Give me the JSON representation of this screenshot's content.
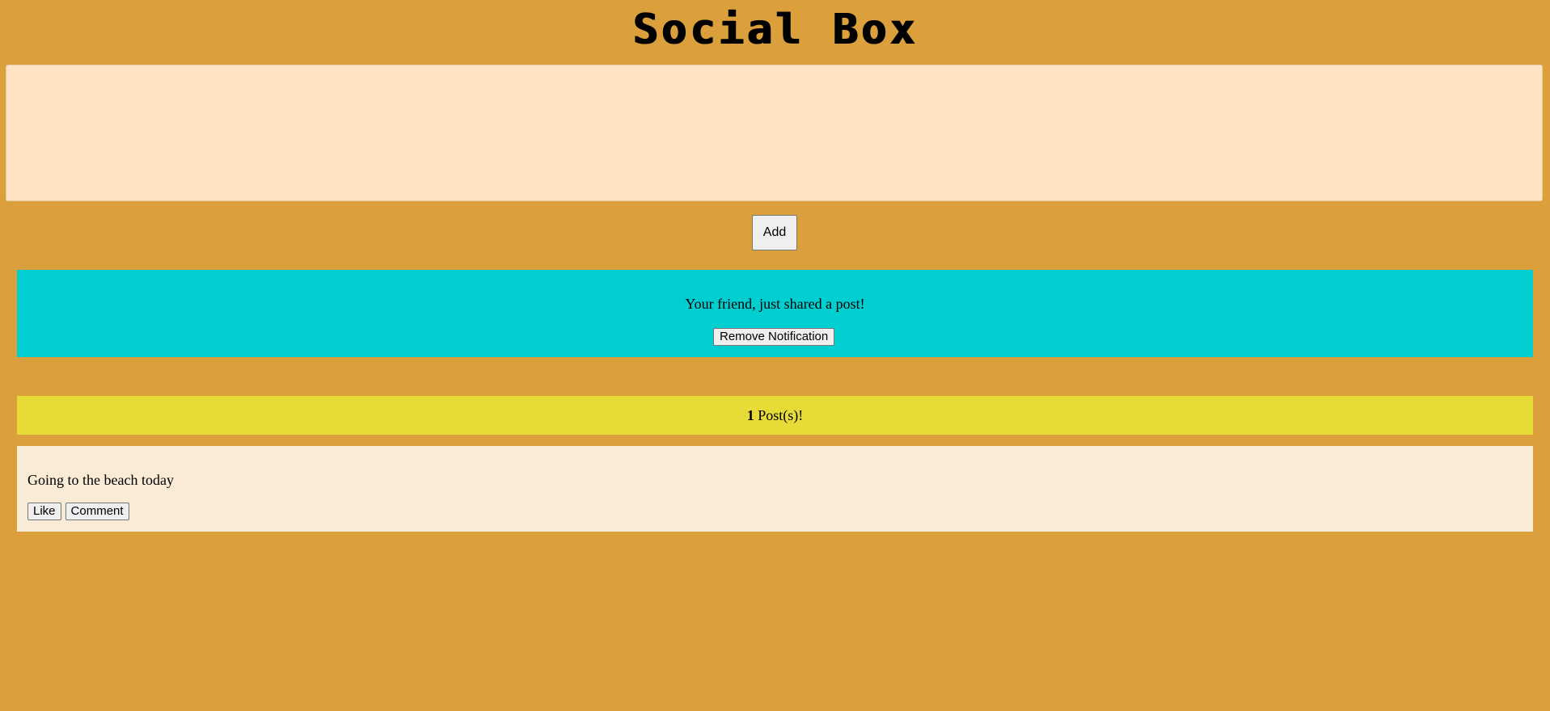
{
  "app": {
    "title": "Social Box"
  },
  "composer": {
    "value": "",
    "placeholder": "",
    "add_label": "Add"
  },
  "notification": {
    "text": "Your friend, just shared a post!",
    "remove_label": "Remove Notification"
  },
  "post_count": {
    "count": "1",
    "suffix": " Post(s)!"
  },
  "posts": [
    {
      "text": "Going to the beach today",
      "like_label": "Like",
      "comment_label": "Comment"
    }
  ],
  "colors": {
    "background": "#dba03c",
    "composer_bg": "#ffe4c4",
    "notification_bg": "#00ced1",
    "count_bar_bg": "#e6db37",
    "post_bg": "#faebd7"
  }
}
